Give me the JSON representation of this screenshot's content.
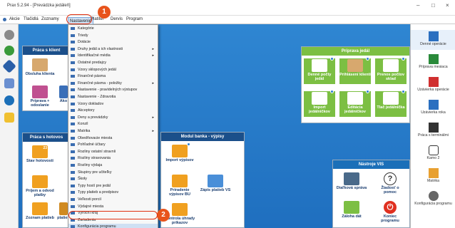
{
  "window": {
    "title": "Prax 5.2.94 - [Prevádzka jedáleň]",
    "min": "–",
    "max": "□",
    "close": "×"
  },
  "menubar": [
    "Akcie",
    "Tlačidlá",
    "Zoznamy",
    "Nastavenie",
    "Platiteľ",
    "Dervis",
    "Program"
  ],
  "dropdown": {
    "items": [
      {
        "label": "Kategórie",
        "arrow": ""
      },
      {
        "label": "Triedy",
        "arrow": ""
      },
      {
        "label": "Dotácie",
        "arrow": ""
      },
      {
        "label": "Druhy jedál a ich vlastnosti",
        "arrow": "▸"
      },
      {
        "label": "Identifikačné média",
        "arrow": "▸"
      },
      {
        "label": "Ostatné predajcy",
        "arrow": ""
      },
      {
        "label": "Vzory sklopových jedál",
        "arrow": ""
      },
      {
        "label": "Finančné pásma",
        "arrow": ""
      },
      {
        "label": "Finančné pásma - položky",
        "arrow": "▸"
      },
      {
        "label": "Nastavenie - pravidelných výstupov",
        "arrow": ""
      },
      {
        "label": "Nastavenie - Zdravotia",
        "arrow": ""
      },
      {
        "label": "Vzory dokladov",
        "arrow": ""
      },
      {
        "label": "Akceptory",
        "arrow": ""
      },
      {
        "label": "Deny a prevádzky",
        "arrow": "▸"
      },
      {
        "label": "Konzil",
        "arrow": ""
      },
      {
        "label": "Matrika",
        "arrow": "▸"
      },
      {
        "label": "Obedňovacie miesta",
        "arrow": ""
      },
      {
        "label": "Pohľadné účtary",
        "arrow": ""
      },
      {
        "label": "Rozliny ostatní stravníi",
        "arrow": ""
      },
      {
        "label": "Rozliny stravovania",
        "arrow": ""
      },
      {
        "label": "Rozliny výdaja",
        "arrow": ""
      },
      {
        "label": "Skupiny pre učiteľky",
        "arrow": ""
      },
      {
        "label": "Škoły",
        "arrow": ""
      },
      {
        "label": "Typy hostí pre jedál",
        "arrow": ""
      },
      {
        "label": "Typy platieb a predpisov",
        "arrow": ""
      },
      {
        "label": "Veľkosti porcií",
        "arrow": ""
      },
      {
        "label": "Výdajné miesta",
        "arrow": ""
      },
      {
        "label": "Výroční kraj",
        "arrow": ""
      },
      {
        "label": "Zariadenia",
        "arrow": ""
      },
      {
        "label": "Konfigurácia programu",
        "arrow": ""
      }
    ]
  },
  "panels": {
    "klient": {
      "title": "Práca s klient",
      "tiles": [
        {
          "label": "Obsluha klienta"
        },
        {
          "label": "Príprava + odoslanie"
        },
        {
          "label": "Ako"
        }
      ]
    },
    "hotovost": {
      "title": "Práca s hotovos",
      "tiles": [
        {
          "label": "Stav hotovosti"
        },
        {
          "label": "Príjem a odvod platby"
        },
        {
          "label": "Zoznam platieb"
        },
        {
          "label": "platieb"
        }
      ],
      "calendar_number": "23"
    },
    "jedal": {
      "title": "Príprava jedál",
      "tiles": [
        {
          "label": "Denné počty jedál"
        },
        {
          "label": "Prihlásení klienti"
        },
        {
          "label": "Prenos počtov sklad"
        },
        {
          "label": "Import jedálničkov"
        },
        {
          "label": "Editácia jedálničkov"
        },
        {
          "label": "Tlač jedálnička"
        }
      ],
      "badges": [
        "A",
        "A",
        "A",
        "A",
        "A",
        "A"
      ]
    },
    "banka": {
      "title": "Modul banka - výpisy",
      "tiles": [
        {
          "label": "Import výpisov"
        },
        {
          "label": "Priradenie výpisov BU"
        },
        {
          "label": "Zápis platieb VS"
        },
        {
          "label": "Kontrola úhrady príkazov"
        }
      ],
      "badges": [
        "1",
        "2",
        "3"
      ]
    },
    "vis": {
      "title": "Nástroje VIS",
      "tiles": [
        {
          "label": "Diaľková správa"
        },
        {
          "label": "Žiadosť o pomoc"
        },
        {
          "label": "Záloha dát"
        },
        {
          "label": "Koniec programu"
        }
      ],
      "help_glyph": "?",
      "power_glyph": "⏻"
    }
  },
  "rightbar": {
    "items": [
      {
        "label": "Denné operácie"
      },
      {
        "label": "Príprava mesiaca"
      },
      {
        "label": "Uzávierka operácie"
      },
      {
        "label": "Uzávierka roka"
      },
      {
        "label": "Práca s terminálmi"
      },
      {
        "label": "Kamo 2"
      },
      {
        "label": "Matrika"
      },
      {
        "label": "Konfigurácia programu"
      }
    ]
  },
  "annotations": {
    "step1": "1",
    "step2": "2"
  },
  "colors": {
    "accent_orange": "#e8541c",
    "panel_header": "#1b4f8a",
    "tile_green": "#7cbf43",
    "desktop_blue": "#2a7ac8"
  }
}
